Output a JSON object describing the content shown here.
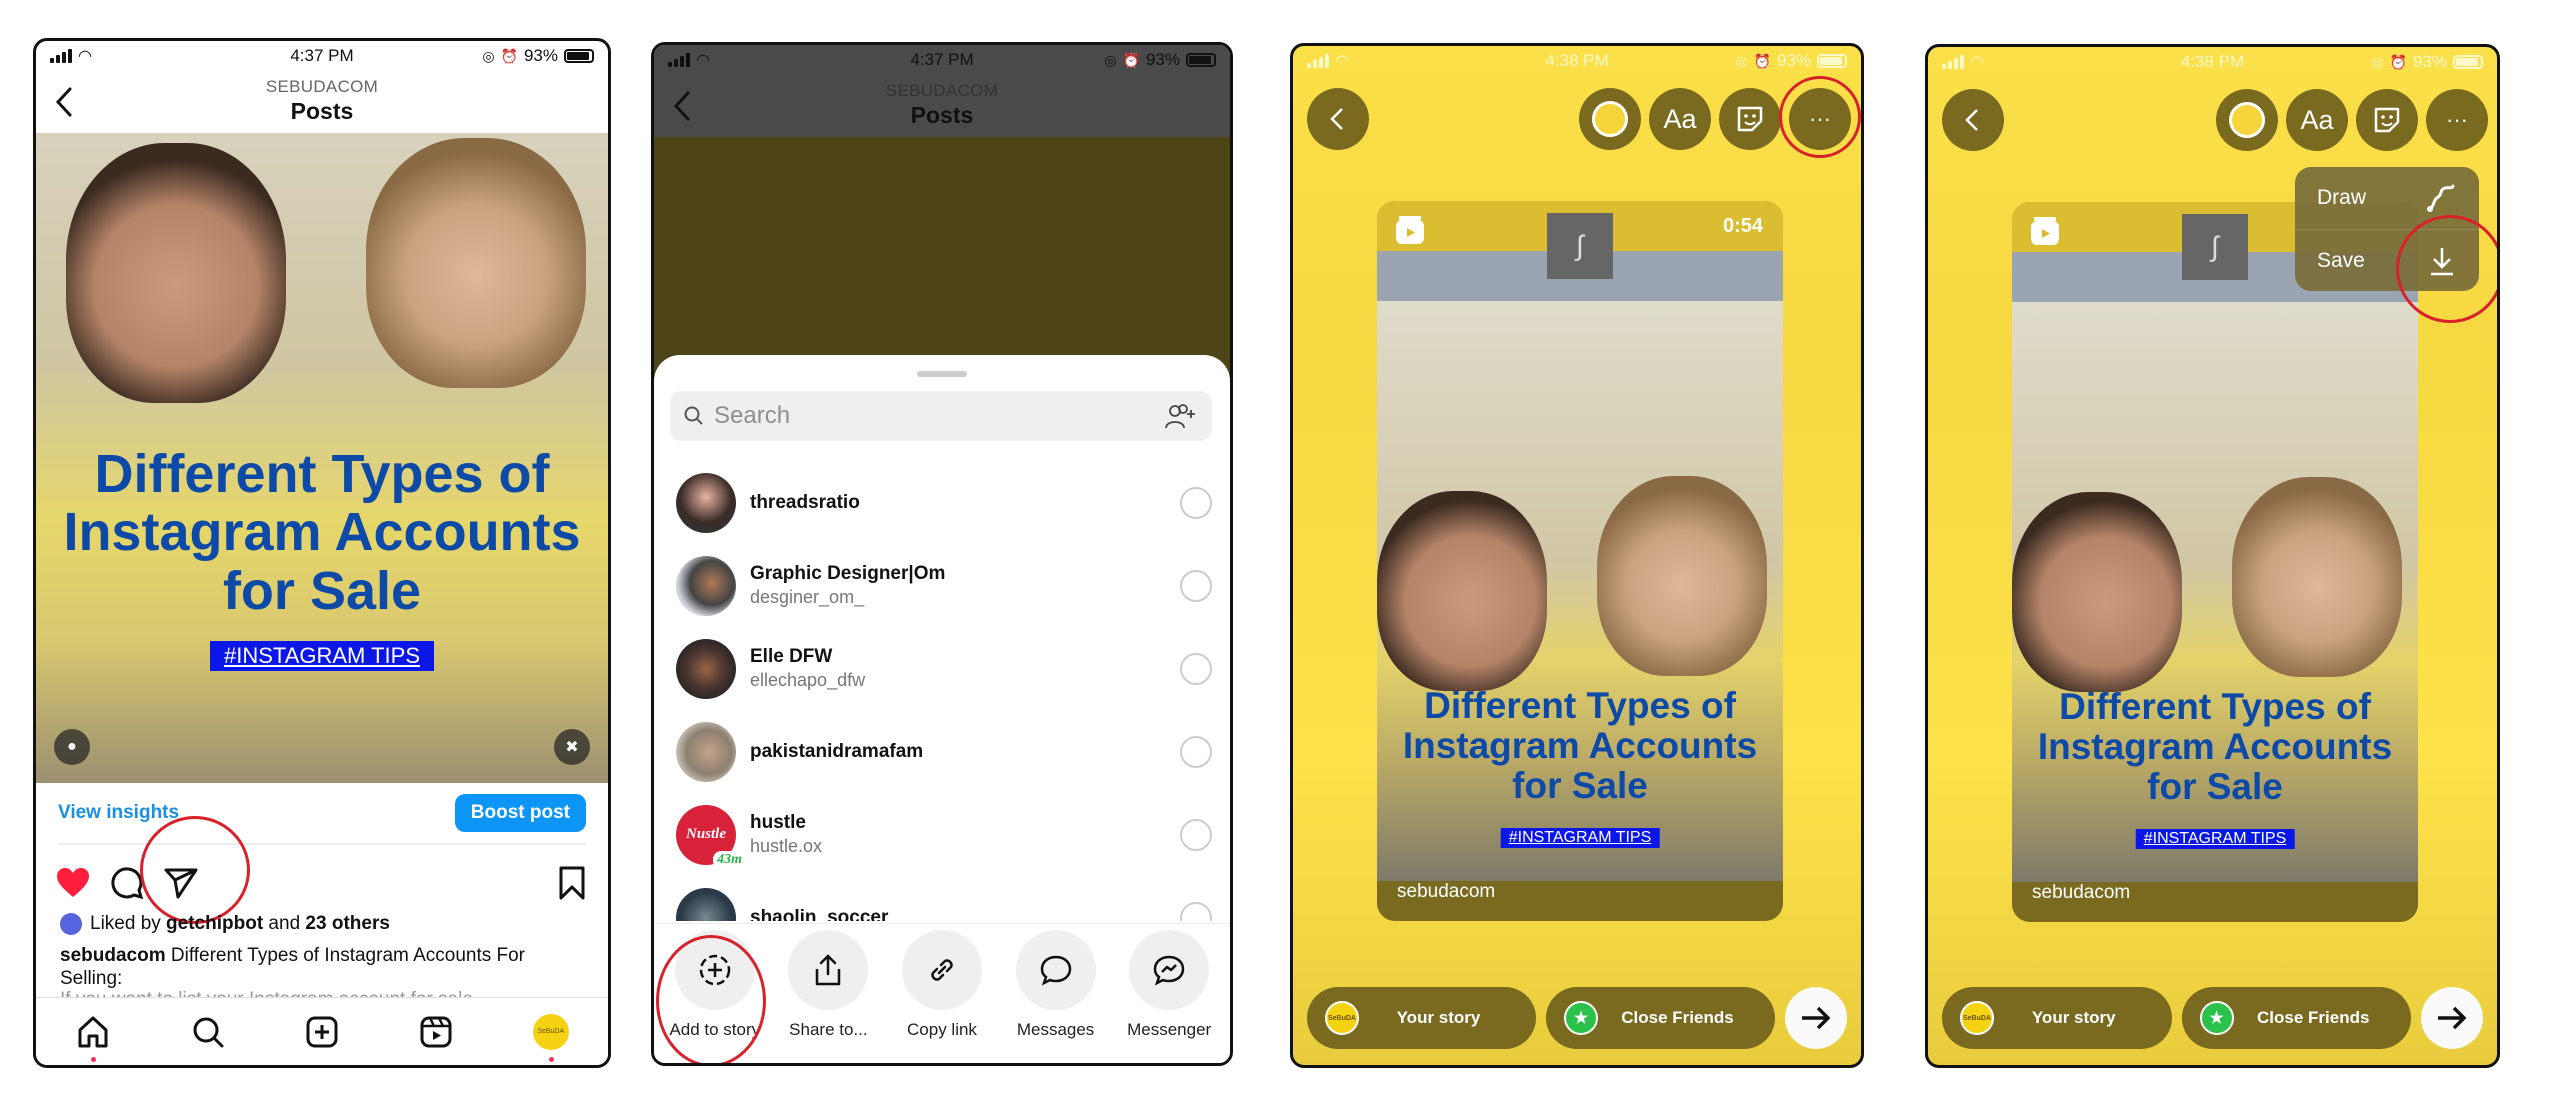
{
  "panels": {
    "post": {
      "status": {
        "time": "4:37 PM",
        "battery": "93%"
      },
      "header": {
        "account": "SEBUDACOM",
        "title": "Posts"
      },
      "image": {
        "headline": [
          "Different Types of",
          "Instagram Accounts",
          "for Sale"
        ],
        "tag": "#INSTAGRAM TIPS"
      },
      "view_insights": "View insights",
      "boost_post": "Boost post",
      "liked_by": {
        "prefix": "Liked by ",
        "user": "getchipbot",
        "middle": " and ",
        "others": "23 others"
      },
      "caption": {
        "user": "sebudacom",
        "text": " Different Types of Instagram Accounts For Selling:"
      },
      "caption_more": "If you want to list your Instagram account for sale...",
      "nav": [
        "home",
        "search",
        "create",
        "reels",
        "profile"
      ],
      "profile_avatar_text": "SeBuDA"
    },
    "share": {
      "status": {
        "time": "4:37 PM",
        "battery": "93%"
      },
      "header": {
        "account": "SEBUDACOM",
        "title": "Posts"
      },
      "search_placeholder": "Search",
      "contacts": [
        {
          "name": "threadsratio",
          "handle": ""
        },
        {
          "name": "Graphic Designer|Om",
          "handle": "desginer_om_"
        },
        {
          "name": "Elle DFW",
          "handle": "ellechapo_dfw"
        },
        {
          "name": "pakistanidramafam",
          "handle": ""
        },
        {
          "name": "hustle",
          "handle": "hustle.ox",
          "badge": "43m",
          "avatar_text": "Nustle"
        },
        {
          "name": "shaolin_soccer",
          "handle": ""
        }
      ],
      "actions": [
        "Add to story",
        "Share to...",
        "Copy link",
        "Messages",
        "Messenger"
      ]
    },
    "story_editor": {
      "status": {
        "time": "4:38 PM",
        "battery": "93%"
      },
      "tools": {
        "text": "Aa",
        "more": "···"
      },
      "card": {
        "duration": "0:54",
        "username": "sebudacom",
        "headline": [
          "Different Types of",
          "Instagram Accounts",
          "for Sale"
        ],
        "tag": "#INSTAGRAM TIPS"
      },
      "your_story": "Your story",
      "close_friends": "Close Friends",
      "avatar_text": "SeBuDA"
    },
    "story_menu": {
      "status": {
        "time": "4:38 PM",
        "battery": "93%"
      },
      "tools": {
        "text": "Aa",
        "more": "···"
      },
      "menu": [
        {
          "label": "Draw",
          "icon": "draw-squiggle-icon"
        },
        {
          "label": "Save",
          "icon": "download-icon"
        }
      ],
      "card": {
        "username": "sebudacom",
        "headline": [
          "Different Types of",
          "Instagram Accounts",
          "for Sale"
        ],
        "tag": "#INSTAGRAM TIPS"
      },
      "your_story": "Your story",
      "close_friends": "Close Friends",
      "avatar_text": "SeBuDA"
    }
  },
  "colors": {
    "annotation": "#d8212a",
    "story_bg": "#fbe04a",
    "story_control": "#7a6a1f",
    "headline": "#0d4aa8",
    "boost": "#0d95f6",
    "like": "#ff1f3d",
    "close_friends": "#2bc24c"
  }
}
